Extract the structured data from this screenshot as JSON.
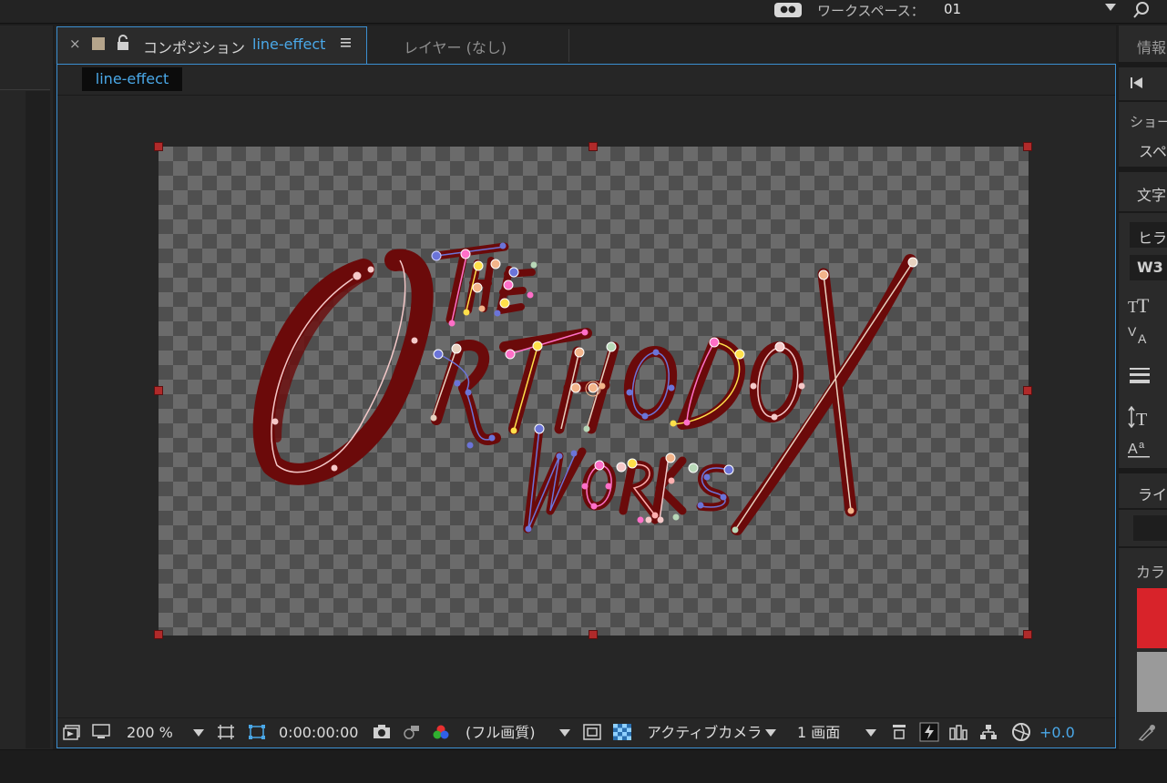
{
  "topbar": {
    "workspace_label": "ワークスペース：",
    "workspace_value": "01",
    "controller_icon": "gamepad-icon",
    "search_icon": "search-icon"
  },
  "tabs": {
    "comp_prefix": "コンポジション",
    "comp_name": "line-effect",
    "layer_tab": "レイヤー (なし)"
  },
  "breadcrumb": "line-effect",
  "artwork": {
    "line1": "THE",
    "line2": "ORTHODOX",
    "line3": "WORKS",
    "stroke_color": "#6b0a0a"
  },
  "bottombar": {
    "zoom": "200 %",
    "timecode": "0:00:00:00",
    "quality": "(フル画質)",
    "camera": "アクティブカメラ",
    "views": "1 画面",
    "exposure": "+0.0"
  },
  "rightpanel": {
    "info": "情報",
    "show": "ショー",
    "space": "スペ",
    "char": "文字",
    "font": "ヒラ",
    "weight": "W3",
    "line": "ライ",
    "color": "カラ"
  },
  "colors": {
    "accent": "#4aa8e8",
    "swatch1": "#d8232a",
    "swatch2": "#9a9a9a"
  }
}
